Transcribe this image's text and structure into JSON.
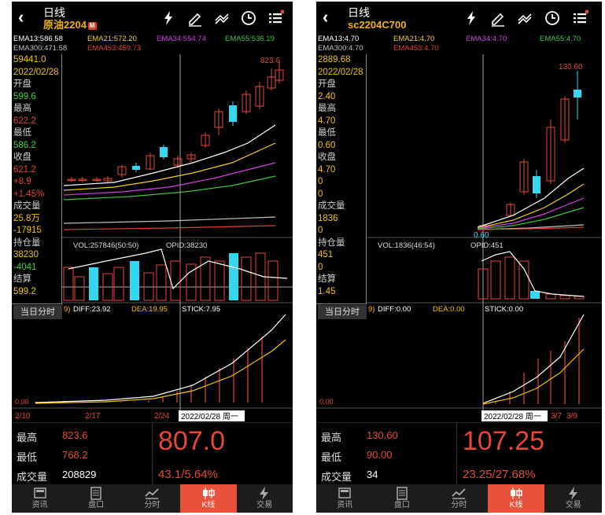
{
  "left": {
    "title": "日线",
    "symbol": "原油2204",
    "market_badge": "M",
    "ema": {
      "ema13": "EMA13:586.58",
      "ema21": "EMA21:572.20",
      "ema34": "EMA34:554.74",
      "ema55": "EMA55:536.19",
      "ema300": "EMA300:471.58",
      "ema453": "EMA453:459.73"
    },
    "info": [
      {
        "text": "59441.0",
        "color": "#f2c200"
      },
      {
        "text": "2022/02/28",
        "color": "#f2c200"
      },
      {
        "text": "开盘",
        "color": "#cccccc"
      },
      {
        "text": "599.6",
        "color": "#3fd13f"
      },
      {
        "text": "最高",
        "color": "#cccccc"
      },
      {
        "text": "622.2",
        "color": "#e54838"
      },
      {
        "text": "最低",
        "color": "#cccccc"
      },
      {
        "text": "586.2",
        "color": "#3fd13f"
      },
      {
        "text": "收盘",
        "color": "#cccccc"
      },
      {
        "text": "621.2",
        "color": "#e54838"
      },
      {
        "text": "+8.9",
        "color": "#e54838"
      },
      {
        "text": "+1.45%",
        "color": "#e54838"
      },
      {
        "text": "成交量",
        "color": "#cccccc"
      },
      {
        "text": "25.8万",
        "color": "#f2c200"
      },
      {
        "text": "-17915",
        "color": "#f2c200"
      },
      {
        "text": "持仓量",
        "color": "#cccccc"
      },
      {
        "text": "38230",
        "color": "#f2c200"
      },
      {
        "text": "-4041",
        "color": "#3fd13f"
      },
      {
        "text": "结算",
        "color": "#cccccc"
      },
      {
        "text": "599.2",
        "color": "#f2c200"
      }
    ],
    "today_btn": "当日分时",
    "peak_label": "823.6",
    "vol_label": "VOL:257846(50:50)",
    "opid_label": "OPID:38230",
    "macd": {
      "prefix": "9)",
      "diff": "DIFF:23.92",
      "dea": "DEA:19.95",
      "stick": "STICK:7.95"
    },
    "macd_zero": "0.00",
    "dates": [
      "2/10",
      "2/17",
      "2/24"
    ],
    "cursor_date": "2022/02/28 周一",
    "stats": {
      "high_label": "最高",
      "high": "823.6",
      "low_label": "最低",
      "low": "768.2",
      "vol_label": "成交量",
      "vol": "208829"
    },
    "price": "807.0",
    "change": "43.1/5.64%"
  },
  "right": {
    "title": "日线",
    "symbol": "sc2204C700",
    "ema": {
      "ema13": "EMA13:4.70",
      "ema21": "EMA21:4.70",
      "ema34": "EMA34:4.70",
      "ema55": "EMA55:4.70",
      "ema300": "EMA300:4.70",
      "ema453": "EMA453:4.70"
    },
    "info": [
      {
        "text": "2889.68",
        "color": "#f2c200"
      },
      {
        "text": "2022/02/28",
        "color": "#f2c200"
      },
      {
        "text": "开盘",
        "color": "#cccccc"
      },
      {
        "text": "2.40",
        "color": "#f2c200"
      },
      {
        "text": "最高",
        "color": "#cccccc"
      },
      {
        "text": "4.70",
        "color": "#f2c200"
      },
      {
        "text": "最低",
        "color": "#cccccc"
      },
      {
        "text": "0.60",
        "color": "#f2c200"
      },
      {
        "text": "收盘",
        "color": "#cccccc"
      },
      {
        "text": "4.70",
        "color": "#f2c200"
      },
      {
        "text": "0",
        "color": "#f2c200"
      },
      {
        "text": "0",
        "color": "#f2c200"
      },
      {
        "text": "成交量",
        "color": "#cccccc"
      },
      {
        "text": "1836",
        "color": "#f2c200"
      },
      {
        "text": "0",
        "color": "#f2c200"
      },
      {
        "text": "持仓量",
        "color": "#cccccc"
      },
      {
        "text": "451",
        "color": "#f2c200"
      },
      {
        "text": "0",
        "color": "#f2c200"
      },
      {
        "text": "结算",
        "color": "#cccccc"
      },
      {
        "text": "1.45",
        "color": "#f2c200"
      }
    ],
    "today_btn": "当日分时",
    "peak_label": "130.60",
    "low_mark": "0.60",
    "vol_label": "VOL:1836(46:54)",
    "opid_label": "OPID:451",
    "macd": {
      "prefix": "9)",
      "diff": "DIFF:0.00",
      "dea": "DEA:0.00",
      "stick": "STICK:0.00"
    },
    "macd_zero": "0.00",
    "dates": [
      "3/7",
      "3/9"
    ],
    "cursor_date": "2022/02/28 周一",
    "stats": {
      "high_label": "最高",
      "high": "130.60",
      "low_label": "最低",
      "low": "90.00",
      "vol_label": "成交量",
      "vol": "34"
    },
    "price": "107.25",
    "change": "23.25/27.68%"
  },
  "nav": [
    "资讯",
    "盘口",
    "分时",
    "K线",
    "交易"
  ],
  "colors": {
    "up": "#e54838",
    "down": "#35d7f0",
    "gold": "#f2c200",
    "ema13": "#ffffff",
    "ema21": "#f0d020",
    "ema34": "#d040e0",
    "ema55": "#40c040",
    "ema300": "#c0c0c0",
    "ema453": "#e04030",
    "accent": "#e8523a"
  }
}
